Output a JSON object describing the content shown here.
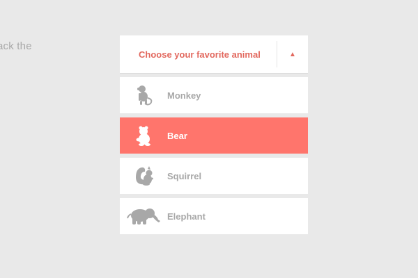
{
  "background": {
    "text": "ack the"
  },
  "dropdown": {
    "title": "Choose your favorite animal",
    "toggle_glyph": "▲",
    "toggle_icon": "triangle-up-icon",
    "accent_color": "#e2685e",
    "selected_color": "#ff756c",
    "selected_index": 1,
    "items": [
      {
        "label": "Monkey",
        "icon": "monkey-icon"
      },
      {
        "label": "Bear",
        "icon": "bear-icon"
      },
      {
        "label": "Squirrel",
        "icon": "squirrel-icon"
      },
      {
        "label": "Elephant",
        "icon": "elephant-icon"
      }
    ]
  }
}
